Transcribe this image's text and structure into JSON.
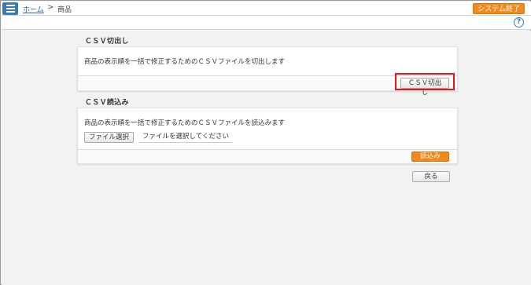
{
  "header": {
    "menu_icon": "hamburger-icon",
    "breadcrumb_home": "ホーム",
    "breadcrumb_separator": ">",
    "breadcrumb_current": "商品",
    "system_exit": "システム終了"
  },
  "subbar": {
    "help_icon": "help-icon",
    "help_glyph": "?"
  },
  "csv_export": {
    "title": "ＣＳＶ切出し",
    "description": "商品の表示順を一括で修正するためのＣＳＶファイルを切出します",
    "button": "ＣＳＶ切出し"
  },
  "csv_import": {
    "title": "ＣＳＶ読込み",
    "description": "商品の表示順を一括で修正するためのＣＳＶファイルを読込みます",
    "file_button": "ファイル選択",
    "file_status": "ファイルを選択してください",
    "submit_button": "読込み"
  },
  "back_button": "戻る",
  "colors": {
    "accent": "#f08a1c",
    "menu": "#3a79b8",
    "highlight": "#e4161b"
  }
}
